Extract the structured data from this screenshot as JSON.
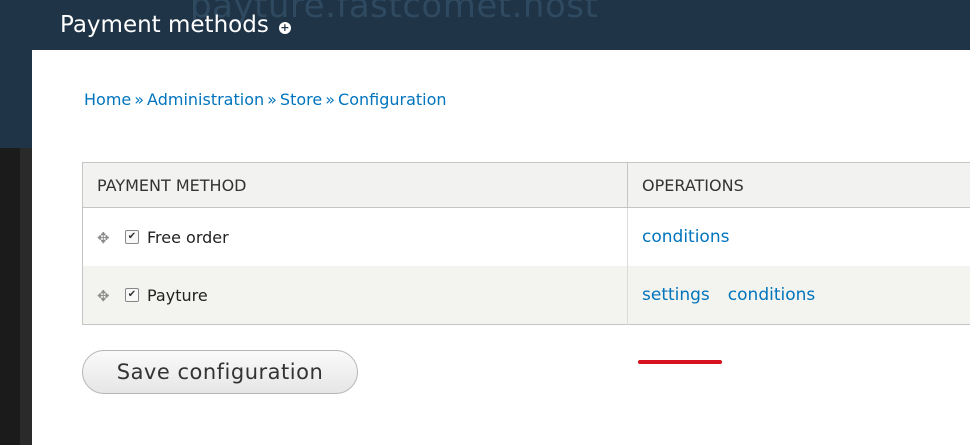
{
  "header": {
    "title": "Payment methods",
    "watermark": "payture.fastcomet.host"
  },
  "breadcrumb": [
    {
      "label": "Home"
    },
    {
      "label": "Administration"
    },
    {
      "label": "Store"
    },
    {
      "label": "Configuration"
    }
  ],
  "breadcrumb_separator": "»",
  "table": {
    "headers": [
      "PAYMENT METHOD",
      "OPERATIONS"
    ],
    "rows": [
      {
        "name": "Free order",
        "enabled": true,
        "operations": [
          "conditions"
        ]
      },
      {
        "name": "Payture",
        "enabled": true,
        "operations": [
          "settings",
          "conditions"
        ]
      }
    ]
  },
  "save_button": "Save configuration",
  "colors": {
    "header_bg": "#1f3446",
    "link": "#0074bd",
    "highlight_underline": "#d8111e"
  }
}
